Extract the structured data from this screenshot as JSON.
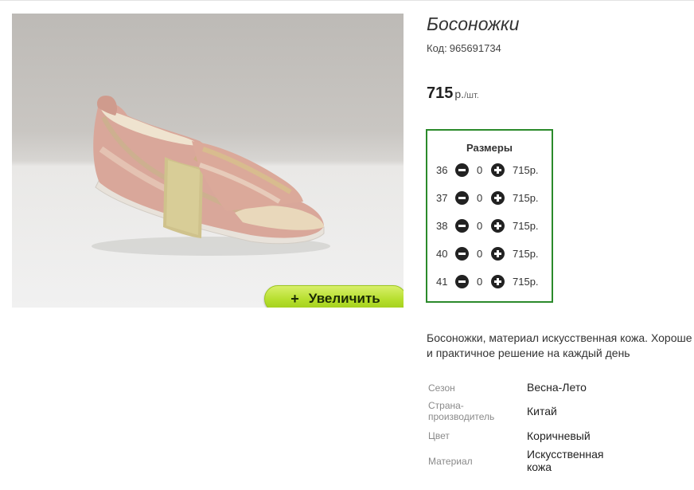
{
  "product": {
    "title": "Босоножки",
    "code_label": "Код:",
    "code_value": "965691734",
    "price_value": "715",
    "price_unit": "р.",
    "price_per": "/шт.",
    "zoom_button_label": "Увеличить",
    "description_line1": "Босоножки, материал искусственная кожа. Хороше",
    "description_line2": "и практичное решение на каждый день"
  },
  "sizes": {
    "heading": "Размеры",
    "rows": [
      {
        "size": "36",
        "qty": "0",
        "price": "715р."
      },
      {
        "size": "37",
        "qty": "0",
        "price": "715р."
      },
      {
        "size": "38",
        "qty": "0",
        "price": "715р."
      },
      {
        "size": "40",
        "qty": "0",
        "price": "715р."
      },
      {
        "size": "41",
        "qty": "0",
        "price": "715р."
      }
    ]
  },
  "specs": [
    {
      "key": "Сезон",
      "value": "Весна-Лето"
    },
    {
      "key": "Страна-производитель",
      "key_line1": "Страна-",
      "key_line2": "производитель",
      "value": "Китай"
    },
    {
      "key": "Цвет",
      "value": "Коричневый"
    },
    {
      "key": "Материал",
      "value": "Искусственная кожа",
      "value_line1": "Искусственная",
      "value_line2": "кожа"
    }
  ],
  "colors": {
    "sizes_border": "#2b8a2b",
    "zoom_button": "#b5de2c"
  },
  "icons": [
    "plus-icon",
    "minus-icon"
  ]
}
